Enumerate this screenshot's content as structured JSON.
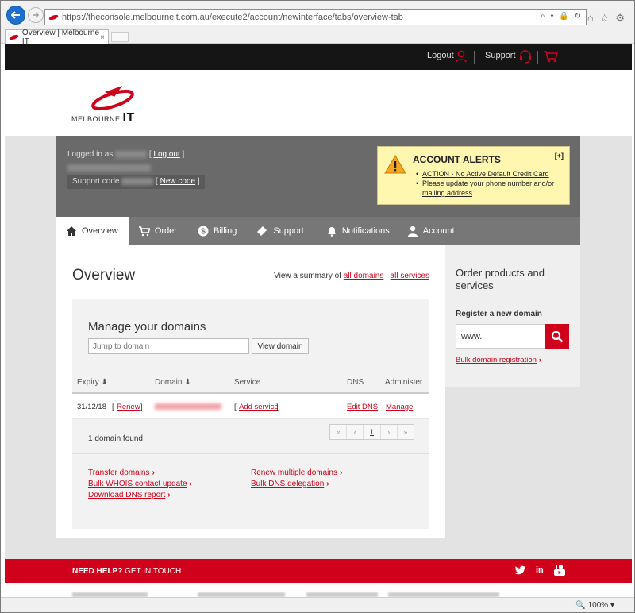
{
  "browser": {
    "url": "https://theconsole.melbourneit.com.au/execute2/account/newinterface/tabs/overview-tab",
    "url_icons": "⌕ ▾ 🔒 ↻",
    "tab_title": "Overview | Melbourne IT",
    "tab_close": "×",
    "zoom": "100%"
  },
  "topbar": {
    "logout": "Logout",
    "support": "Support"
  },
  "logo": {
    "brand_small": "MELBOURNE",
    "brand_big": "IT"
  },
  "account": {
    "logged_in_label": "Logged in as",
    "logout_link": "Log out",
    "support_code_label": "Support code",
    "new_code_link": "New code"
  },
  "alerts": {
    "title": "ACCOUNT ALERTS",
    "toggle": "[+]",
    "items": [
      "ACTION - No Active Default Credit Card",
      "Please update your phone number and/or mailing address"
    ]
  },
  "nav": {
    "tabs": [
      {
        "label": "Overview",
        "icon": "home-icon"
      },
      {
        "label": "Order",
        "icon": "cart-icon"
      },
      {
        "label": "Billing",
        "icon": "dollar-icon"
      },
      {
        "label": "Support",
        "icon": "ticket-icon"
      },
      {
        "label": "Notifications",
        "icon": "bell-icon"
      },
      {
        "label": "Account",
        "icon": "user-icon"
      }
    ]
  },
  "main": {
    "title": "Overview",
    "summary_prefix": "View a summary of",
    "all_domains": "all domains",
    "pipe": "|",
    "all_services": "all services"
  },
  "domains": {
    "title": "Manage your domains",
    "jump_placeholder": "Jump to domain",
    "view_button": "View domain",
    "headers": {
      "expiry": "Expiry ⬍",
      "domain": "Domain ⬍",
      "service": "Service",
      "dns": "DNS",
      "administer": "Administer"
    },
    "row": {
      "expiry": "31/12/18",
      "renew_open": "[",
      "renew": "Renew",
      "renew_close": "]",
      "add_service_open": "[",
      "add_service": "Add service",
      "add_service_close": "]",
      "dns": "Edit DNS",
      "administer": "Manage"
    },
    "found": "1 domain found",
    "pager": [
      "«",
      "‹",
      "1",
      "›",
      "»"
    ],
    "links": {
      "transfer": "Transfer domains",
      "whois": "Bulk WHOIS contact update",
      "dns_report": "Download DNS report",
      "renew_multi": "Renew multiple domains",
      "bulk_dns": "Bulk DNS delegation"
    }
  },
  "sidebar": {
    "title": "Order products and services",
    "subtitle": "Register a new domain",
    "input_value": "www.",
    "bulk_link": "Bulk domain registration"
  },
  "footer": {
    "help_bold": "NEED HELP?",
    "help_rest": "GET IN TOUCH",
    "social": {
      "twitter": "🐦",
      "linkedin": "in",
      "youtube": "You"
    }
  },
  "colors": {
    "brand_red": "#d0021b",
    "dark": "#151515",
    "alert_bg": "#fff7b0"
  }
}
